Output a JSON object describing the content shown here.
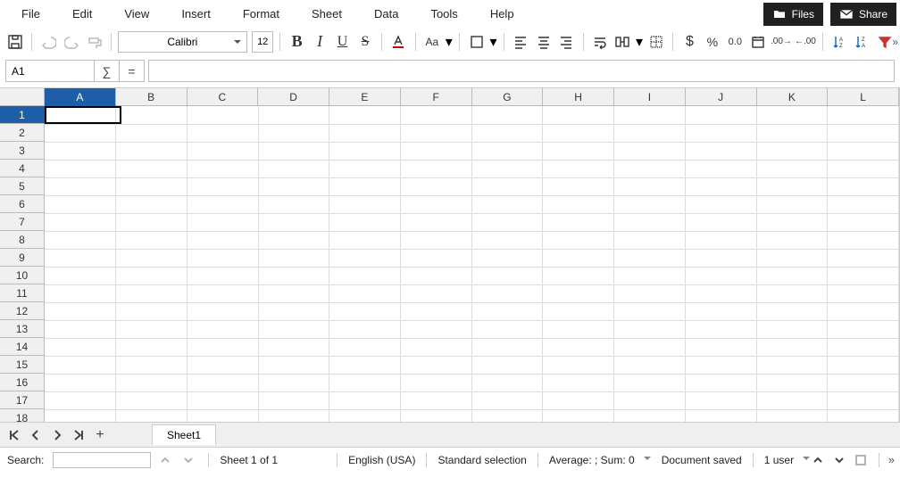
{
  "menubar": {
    "items": [
      "File",
      "Edit",
      "View",
      "Insert",
      "Format",
      "Sheet",
      "Data",
      "Tools",
      "Help"
    ],
    "files_btn": "Files",
    "share_btn": "Share"
  },
  "toolbar": {
    "font_name": "Calibri",
    "font_size": "12"
  },
  "formula_bar": {
    "cell_ref": "A1",
    "sigma": "∑",
    "equals": "=",
    "formula_value": ""
  },
  "grid": {
    "columns": [
      "A",
      "B",
      "C",
      "D",
      "E",
      "F",
      "G",
      "H",
      "I",
      "J",
      "K",
      "L"
    ],
    "rows": [
      "1",
      "2",
      "3",
      "4",
      "5",
      "6",
      "7",
      "8",
      "9",
      "10",
      "11",
      "12",
      "13",
      "14",
      "15",
      "16",
      "17",
      "18"
    ],
    "selected_col": "A",
    "selected_row": "1"
  },
  "sheet_nav": {
    "add": "+",
    "tab_label": "Sheet1"
  },
  "status": {
    "search_label": "Search:",
    "sheet_count": "Sheet 1 of 1",
    "language": "English (USA)",
    "selection_mode": "Standard selection",
    "summary": "Average: ; Sum: 0",
    "save_state": "Document saved",
    "users": "1 user",
    "more": "»"
  }
}
